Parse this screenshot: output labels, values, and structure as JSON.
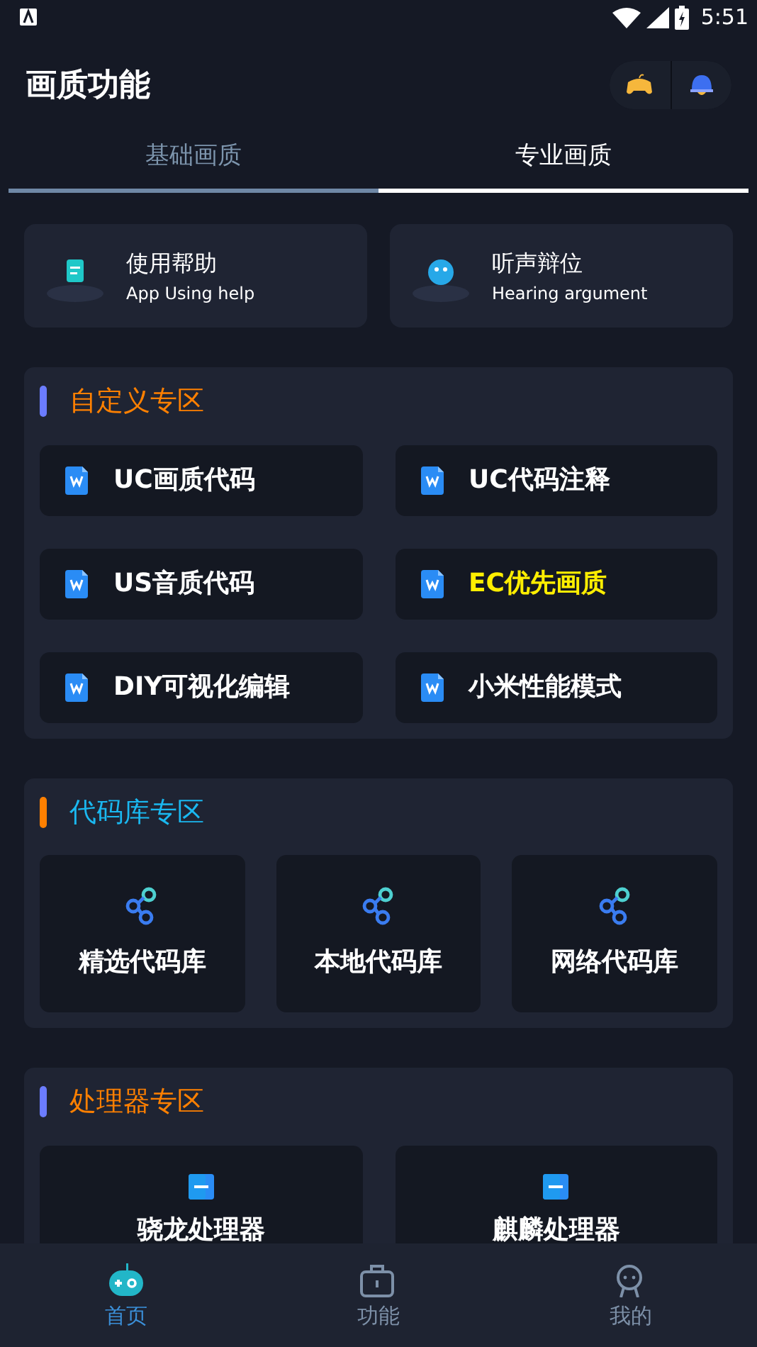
{
  "status_bar": {
    "time": "5:51"
  },
  "app_bar": {
    "title": "画质功能"
  },
  "tabs": [
    {
      "label": "基础画质",
      "selected": false
    },
    {
      "label": "专业画质",
      "selected": true
    }
  ],
  "help_cards": [
    {
      "kind": "document",
      "title": "使用帮助",
      "subtitle": "App Using help"
    },
    {
      "kind": "bubble",
      "title": "听声辩位",
      "subtitle": "Hearing argument"
    }
  ],
  "sections": [
    {
      "title": "自定义专区",
      "color": "#ff8000",
      "accent": {
        "color": "#6b7cff"
      },
      "kind": "list",
      "items": [
        {
          "label": "UC画质代码",
          "highlighted": false
        },
        {
          "label": "UC代码注释",
          "highlighted": false
        },
        {
          "label": "US音质代码",
          "highlighted": false
        },
        {
          "label": "EC优先画质",
          "highlighted": true
        },
        {
          "label": "DIY可视化编辑",
          "highlighted": false
        },
        {
          "label": "小米性能模式",
          "highlighted": false
        }
      ]
    },
    {
      "title": "代码库专区",
      "color": "#1ab8f0",
      "accent": {
        "color": "#ff8000"
      },
      "kind": "share",
      "items": [
        {
          "label": "精选代码库",
          "highlighted": false
        },
        {
          "label": "本地代码库",
          "highlighted": false
        },
        {
          "label": "网络代码库",
          "highlighted": false
        }
      ]
    },
    {
      "title": "处理器专区",
      "color": "#ff8000",
      "accent": {
        "color": "#6b7cff"
      },
      "kind": "chip",
      "items": [
        {
          "label": "骁龙处理器",
          "highlighted": false
        },
        {
          "label": "麒麟处理器",
          "highlighted": false
        }
      ]
    }
  ],
  "bottom_nav": [
    {
      "kind": "home",
      "label": "首页",
      "selected": true
    },
    {
      "kind": "tools",
      "label": "功能",
      "selected": false
    },
    {
      "kind": "profile",
      "label": "我的",
      "selected": false
    }
  ]
}
